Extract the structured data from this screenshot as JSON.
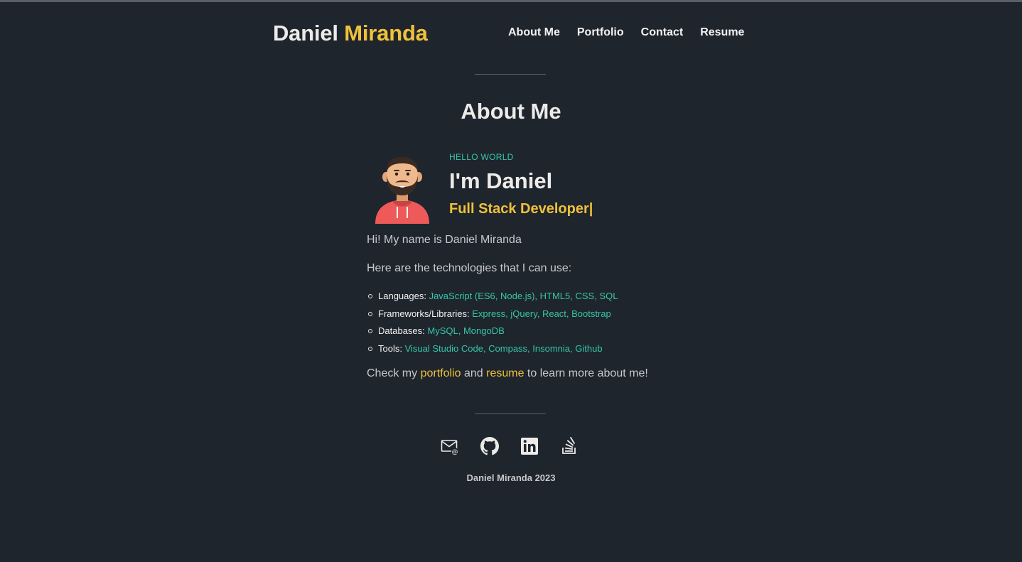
{
  "header": {
    "brand_first": "Daniel",
    "brand_last": "Miranda",
    "nav": [
      {
        "label": "About Me"
      },
      {
        "label": "Portfolio"
      },
      {
        "label": "Contact"
      },
      {
        "label": "Resume"
      }
    ]
  },
  "about": {
    "title": "About Me",
    "greeting": "HELLO WORLD",
    "name_line": "I'm Daniel",
    "role": "Full Stack Developer",
    "cursor": "|",
    "intro": "Hi! My name is Daniel Miranda",
    "tech_intro": "Here are the technologies that I can use:",
    "technologies": [
      {
        "label": "Languages:",
        "values": "JavaScript (ES6, Node.js), HTML5, CSS, SQL"
      },
      {
        "label": "Frameworks/Libraries:",
        "values": "Express, jQuery, React, Bootstrap"
      },
      {
        "label": "Databases:",
        "values": "MySQL, MongoDB"
      },
      {
        "label": "Tools:",
        "values": "Visual Studio Code, Compass, Insomnia, Github"
      }
    ],
    "cta_prefix": "Check my",
    "cta_portfolio": "portfolio",
    "cta_and": "and",
    "cta_resume": "resume",
    "cta_suffix": "to learn more about me!"
  },
  "footer": {
    "socials": [
      "email-icon",
      "github-icon",
      "linkedin-icon",
      "stackoverflow-icon"
    ],
    "copyright": "Daniel Miranda 2023"
  },
  "colors": {
    "background": "#1f252d",
    "accent_yellow": "#f0c13a",
    "accent_teal": "#35c5a8",
    "text_light": "#ecebe8",
    "text_muted": "#c6c8cb"
  }
}
